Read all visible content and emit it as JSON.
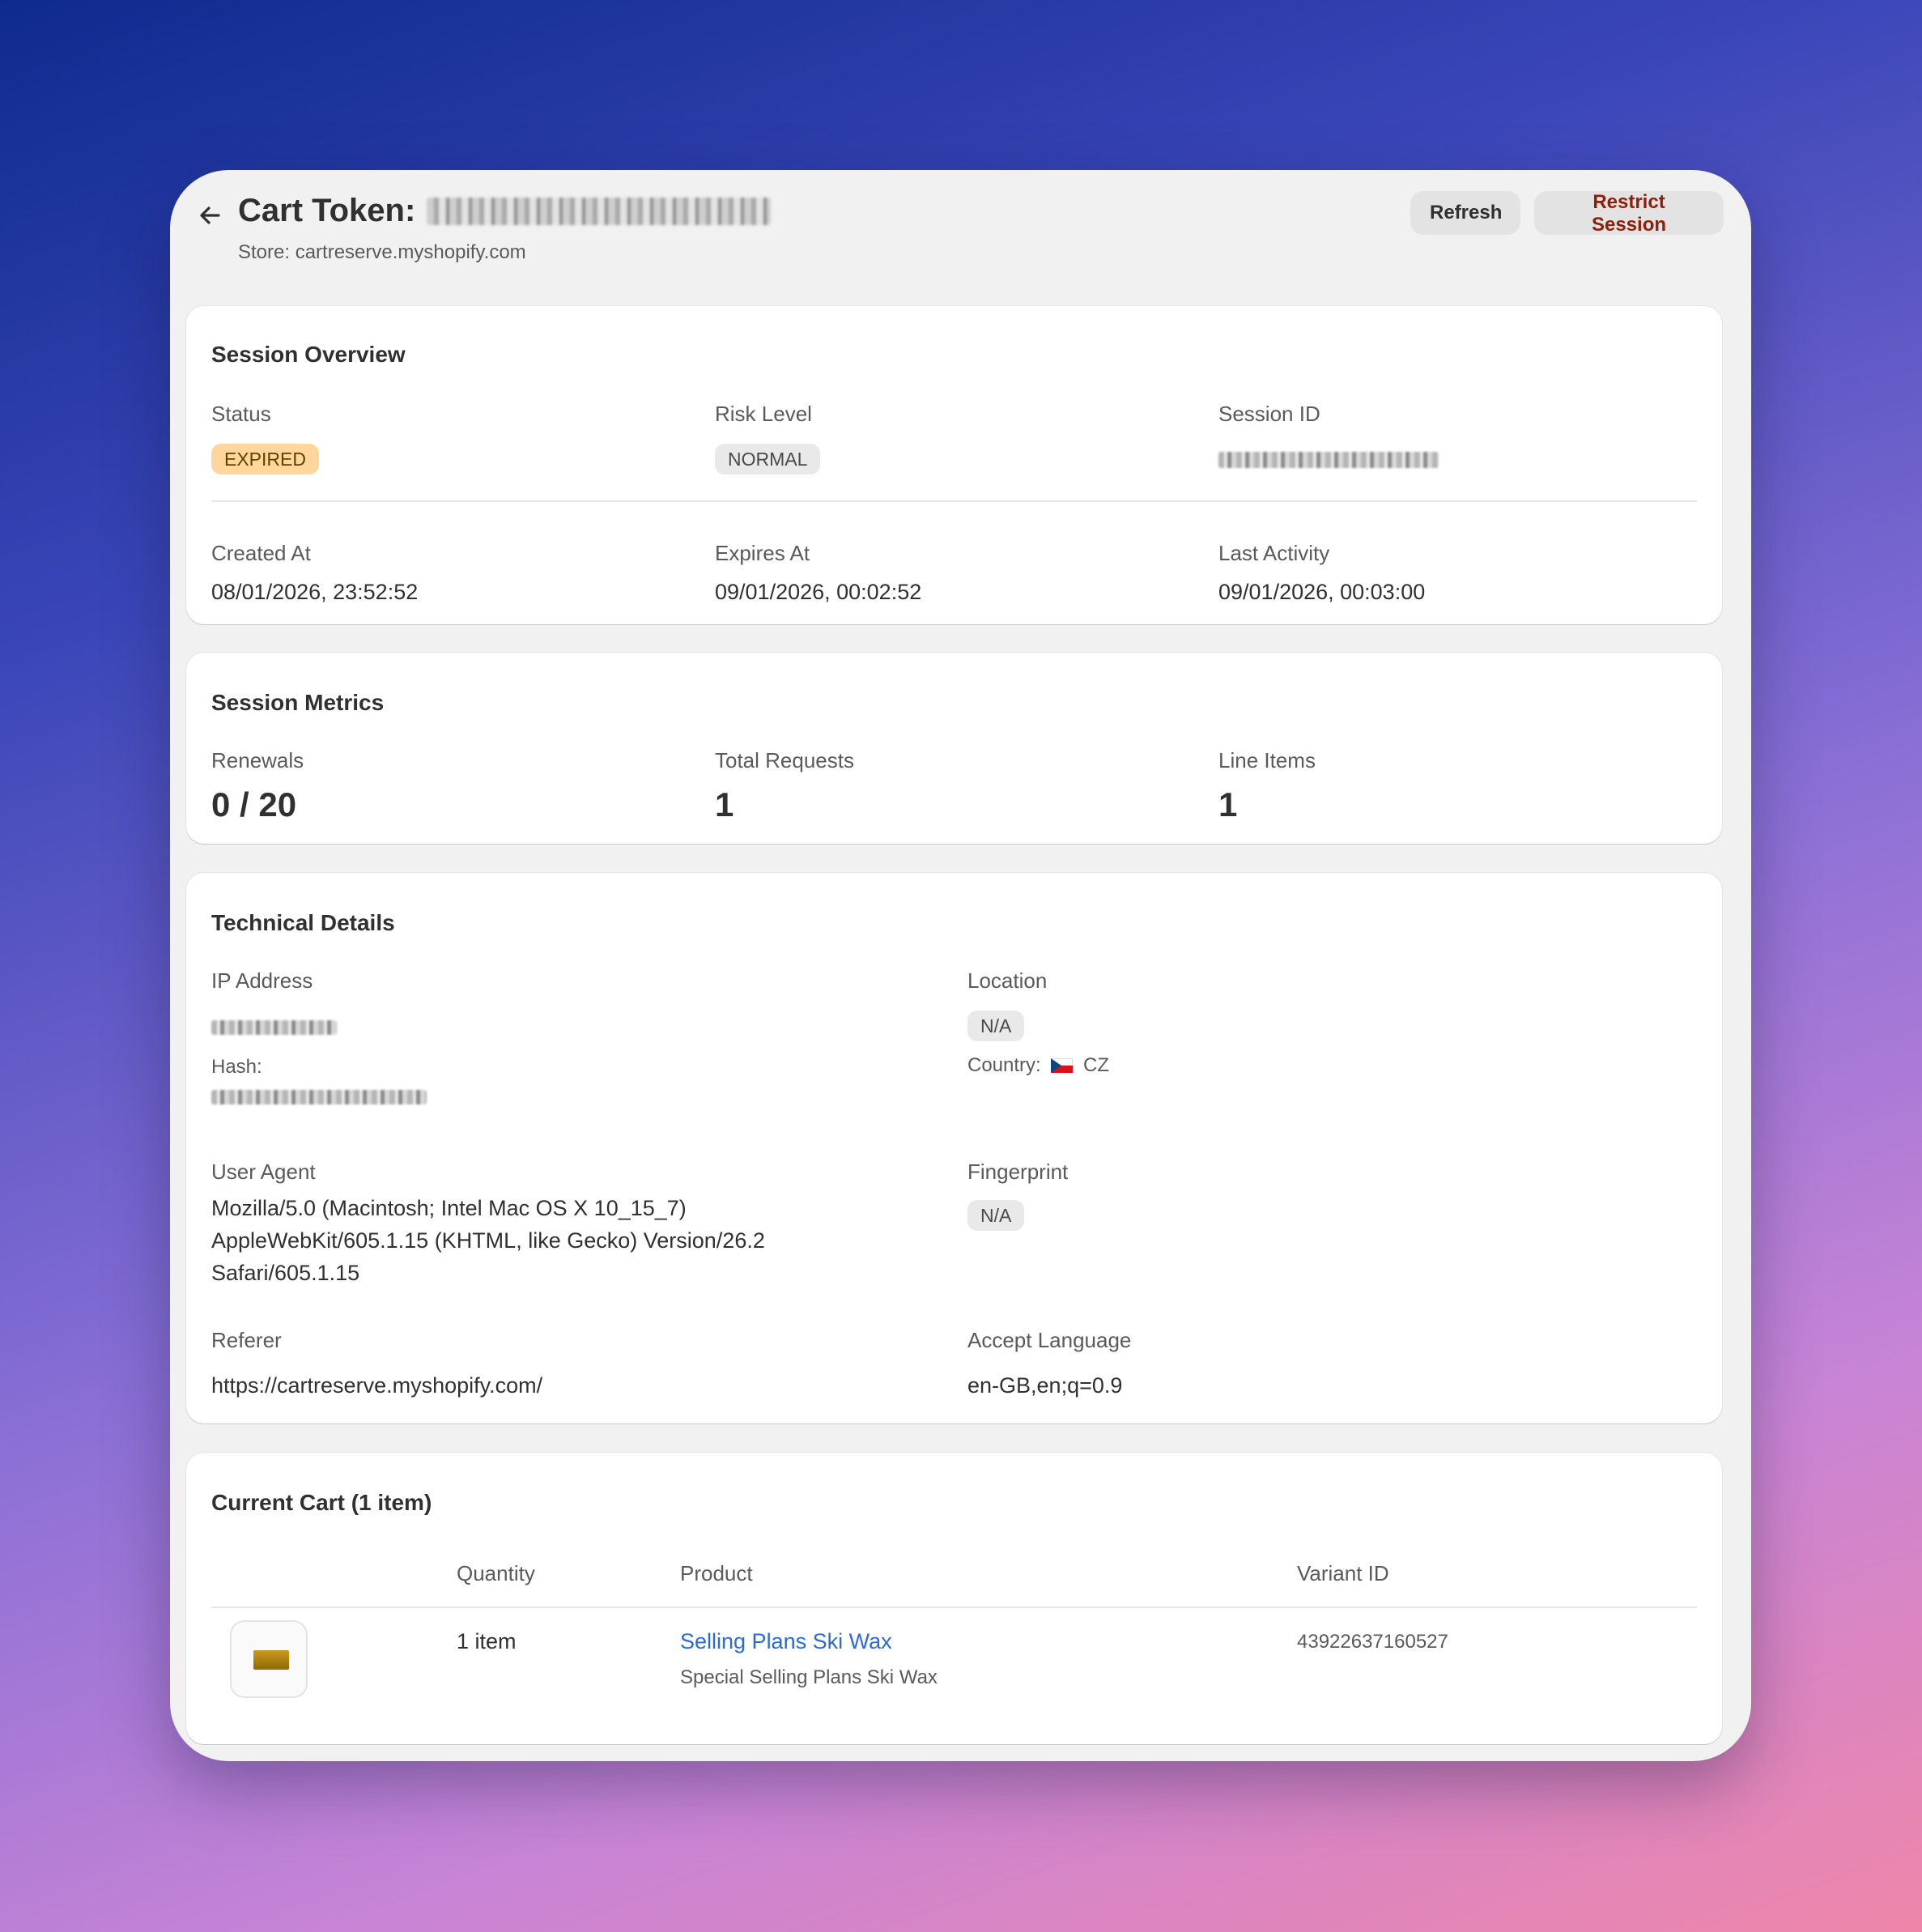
{
  "header": {
    "title": "Cart Token:",
    "store": "Store: cartreserve.myshopify.com",
    "refresh_label": "Refresh",
    "restrict_label": "Restrict Session"
  },
  "overview": {
    "title": "Session Overview",
    "status_label": "Status",
    "status_value": "EXPIRED",
    "risk_label": "Risk Level",
    "risk_value": "NORMAL",
    "session_id_label": "Session ID",
    "created_label": "Created At",
    "created_value": "08/01/2026, 23:52:52",
    "expires_label": "Expires At",
    "expires_value": "09/01/2026, 00:02:52",
    "last_activity_label": "Last Activity",
    "last_activity_value": "09/01/2026, 00:03:00"
  },
  "metrics": {
    "title": "Session Metrics",
    "renewals_label": "Renewals",
    "renewals_value": "0 / 20",
    "requests_label": "Total Requests",
    "requests_value": "1",
    "line_items_label": "Line Items",
    "line_items_value": "1"
  },
  "technical": {
    "title": "Technical Details",
    "ip_label": "IP Address",
    "hash_label": "Hash:",
    "location_label": "Location",
    "location_value": "N/A",
    "country_label": "Country:",
    "country_value": "CZ",
    "user_agent_label": "User Agent",
    "user_agent_value": "Mozilla/5.0 (Macintosh; Intel Mac OS X 10_15_7) AppleWebKit/605.1.15 (KHTML, like Gecko) Version/26.2 Safari/605.1.15",
    "fingerprint_label": "Fingerprint",
    "fingerprint_value": "N/A",
    "referer_label": "Referer",
    "referer_value": "https://cartreserve.myshopify.com/",
    "accept_language_label": "Accept Language",
    "accept_language_value": "en-GB,en;q=0.9"
  },
  "cart": {
    "title": "Current Cart (1 item)",
    "columns": [
      "Quantity",
      "Product",
      "Variant ID"
    ],
    "rows": [
      {
        "quantity": "1 item",
        "product": "Selling Plans Ski Wax",
        "product_subtitle": "Special Selling Plans Ski Wax",
        "variant_id": "43922637160527"
      }
    ]
  },
  "icons": {
    "back": "arrow-left-icon",
    "product_thumb": "ski-wax-thumbnail",
    "country_flag": "czech-flag-icon"
  },
  "colors": {
    "expired_badge_bg": "#ffd79d",
    "restrict_text": "#8e1f0b",
    "link": "#2b6ad8"
  }
}
